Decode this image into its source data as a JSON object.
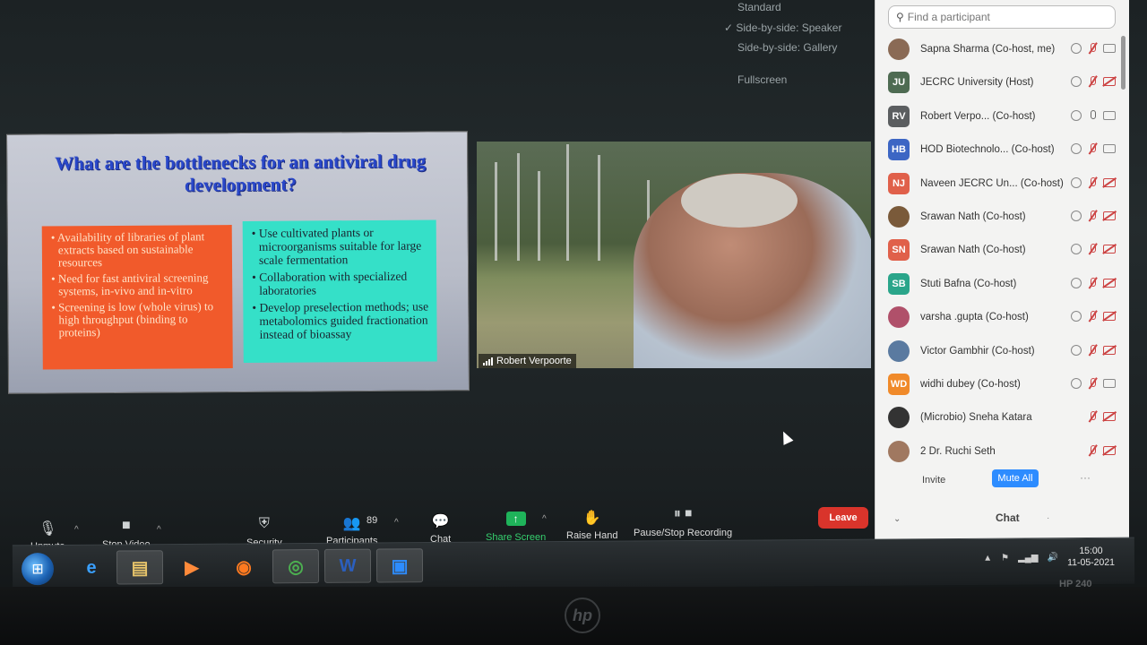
{
  "view_menu": {
    "items": [
      "Standard",
      "✓ Side-by-side: Speaker",
      "Side-by-side: Gallery",
      "Fullscreen"
    ]
  },
  "slide": {
    "title": "What are the bottlenecks for an antiviral drug development?",
    "left_bullets": [
      "Availability of libraries of plant extracts based on sustainable resources",
      "Need for fast antiviral screening systems, in-vivo and in-vitro",
      "Screening is low (whole virus) to high throughput (binding to proteins)"
    ],
    "right_bullets": [
      "Use cultivated plants or microorganisms suitable for large scale fermentation",
      "Collaboration with specialized laboratories",
      "Develop preselection methods; use metabolomics guided fractionation instead of bioassay"
    ]
  },
  "video": {
    "speaker_name": "Robert Verpoorte"
  },
  "participants_panel": {
    "search_placeholder": "Find a participant",
    "participants": [
      {
        "initials": "",
        "name": "Sapna Sharma (Co-host, me)",
        "color": "#8a6a55",
        "mic": "muted",
        "video": "on"
      },
      {
        "initials": "JU",
        "name": "JECRC University (Host)",
        "color": "#4e6b52",
        "mic": "muted",
        "video": "off"
      },
      {
        "initials": "RV",
        "name": "Robert Verpo... (Co-host)",
        "color": "#5b5e60",
        "mic": "on",
        "video": "on"
      },
      {
        "initials": "HB",
        "name": "HOD Biotechnolo... (Co-host)",
        "color": "#3c66c4",
        "mic": "muted",
        "video": "on"
      },
      {
        "initials": "NJ",
        "name": "Naveen JECRC Un... (Co-host)",
        "color": "#e0604a",
        "mic": "muted",
        "video": "off"
      },
      {
        "initials": "",
        "name": "Srawan Nath (Co-host)",
        "color": "#7a5a3a",
        "mic": "muted",
        "video": "off"
      },
      {
        "initials": "SN",
        "name": "Srawan Nath (Co-host)",
        "color": "#e0604a",
        "mic": "muted",
        "video": "off"
      },
      {
        "initials": "SB",
        "name": "Stuti Bafna (Co-host)",
        "color": "#2aa58a",
        "mic": "muted",
        "video": "off"
      },
      {
        "initials": "",
        "name": "varsha .gupta (Co-host)",
        "color": "#b0506a",
        "mic": "muted",
        "video": "off"
      },
      {
        "initials": "",
        "name": "Victor Gambhir (Co-host)",
        "color": "#5a7aa0",
        "mic": "muted",
        "video": "off"
      },
      {
        "initials": "WD",
        "name": "widhi dubey (Co-host)",
        "color": "#f08a2a",
        "mic": "muted",
        "video": "on"
      },
      {
        "initials": "",
        "name": "(Microbio) Sneha Katara",
        "color": "#333333",
        "mic": "muted",
        "video": "off"
      },
      {
        "initials": "",
        "name": "2 Dr. Ruchi Seth",
        "color": "#a07860",
        "mic": "muted",
        "video": "off"
      }
    ],
    "invite_label": "Invite",
    "mute_all_label": "Mute All",
    "more_label": "···",
    "chat_label": "Chat"
  },
  "toolbar": {
    "unmute_label": "Unmute",
    "stop_video_label": "Stop Video",
    "security_label": "Security",
    "participants_label": "Participants",
    "participants_count": "89",
    "chat_label": "Chat",
    "share_label": "Share Screen",
    "raise_hand_label": "Raise Hand",
    "recording_label": "Pause/Stop Recording",
    "leave_label": "Leave"
  },
  "taskbar": {
    "time": "15:00",
    "date": "11-05-2021"
  },
  "bezel": {
    "model": "HP 240",
    "logo": "hp"
  }
}
